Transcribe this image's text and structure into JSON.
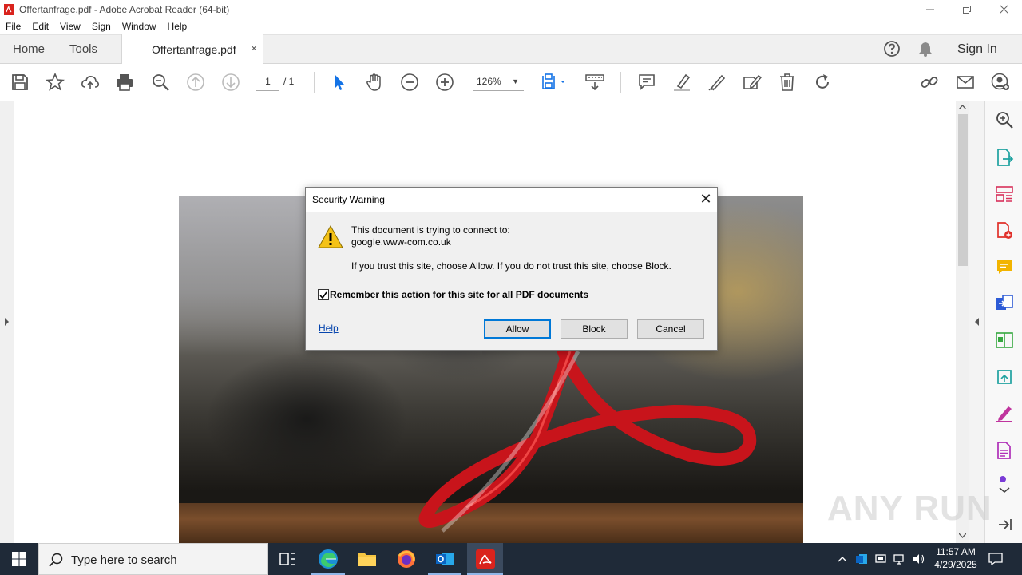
{
  "window": {
    "title": "Offertanfrage.pdf - Adobe Acrobat Reader (64-bit)"
  },
  "menu": [
    "File",
    "Edit",
    "View",
    "Sign",
    "Window",
    "Help"
  ],
  "tabs": {
    "home": "Home",
    "tools": "Tools",
    "document": "Offertanfrage.pdf",
    "close": "×"
  },
  "header": {
    "sign_in": "Sign In"
  },
  "toolbar": {
    "page_current": "1",
    "page_total": "/ 1",
    "zoom": "126%"
  },
  "dialog": {
    "title": "Security Warning",
    "close": "✕",
    "line1": "This document is trying to connect to:",
    "host": "googIe.www-com.co.uk",
    "line2": "If you trust this site, choose Allow. If you do not trust this site, choose Block.",
    "remember_label": "Remember this action for this site for all PDF documents",
    "remember_checked": true,
    "help": "Help",
    "allow": "Allow",
    "block": "Block",
    "cancel": "Cancel"
  },
  "watermark": "ANY RUN",
  "taskbar": {
    "search_placeholder": "Type here to search",
    "time": "11:57 AM",
    "date": "4/29/2025"
  },
  "colors": {
    "acrobat_red": "#d9231d",
    "taskbar": "#1f2a38",
    "link_blue": "#0645ad",
    "focus_blue": "#0078d7",
    "tool_blue": "#1473e6"
  }
}
